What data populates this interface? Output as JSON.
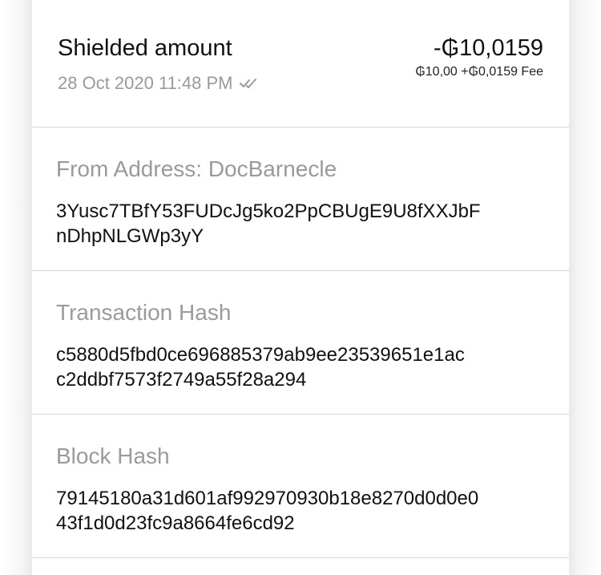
{
  "transaction": {
    "title": "Shielded amount",
    "datetime": "28 Oct 2020 11:48 PM",
    "status_icon": "double-check-icon",
    "amount": "-₲10,0159",
    "breakdown": "₲10,00 +₲0,0159 Fee"
  },
  "details": [
    {
      "label": "From Address: DocBarnecle",
      "value_lines": [
        "3Yusc7TBfY53FUDcJg5ko2PpCBUgE9U8fXXJbF",
        "nDhpNLGWp3yY"
      ]
    },
    {
      "label": "Transaction Hash",
      "value_lines": [
        "c5880d5fbd0ce696885379ab9ee23539651e1ac",
        "c2ddbf7573f2749a55f28a294"
      ]
    },
    {
      "label": "Block Hash",
      "value_lines": [
        "79145180a31d601af992970930b18e8270d0d0e0",
        "43f1d0d23fc9a8664fe6cd92"
      ]
    }
  ],
  "colors": {
    "text_primary": "#111111",
    "text_secondary": "#9a9a9a",
    "divider": "#d9d9d9",
    "background": "#ffffff"
  }
}
